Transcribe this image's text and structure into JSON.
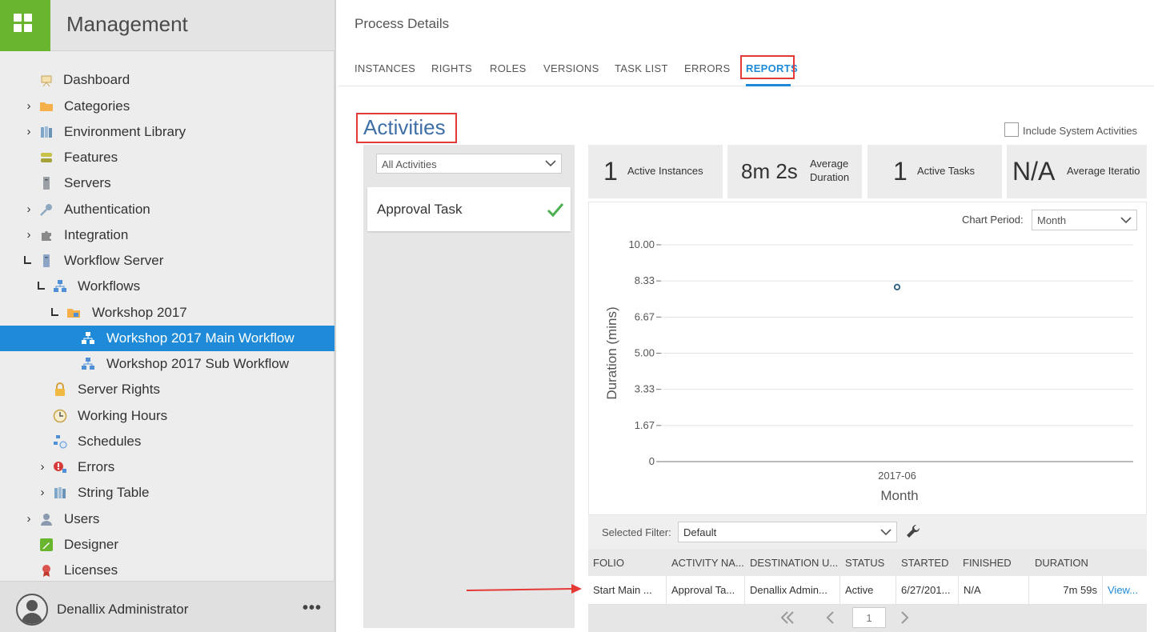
{
  "app": {
    "title": "Management"
  },
  "sidebar": {
    "items": [
      {
        "label": "Dashboard",
        "icon": "dashboard-icon"
      },
      {
        "label": "Categories",
        "icon": "folder-icon"
      },
      {
        "label": "Environment Library",
        "icon": "library-icon"
      },
      {
        "label": "Features",
        "icon": "features-icon"
      },
      {
        "label": "Servers",
        "icon": "server-icon"
      },
      {
        "label": "Authentication",
        "icon": "key-icon"
      },
      {
        "label": "Integration",
        "icon": "puzzle-icon"
      },
      {
        "label": "Workflow Server",
        "icon": "server-icon"
      },
      {
        "label": "Workflows",
        "icon": "workflow-icon"
      },
      {
        "label": "Workshop 2017",
        "icon": "workflow-folder-icon"
      },
      {
        "label": "Workshop 2017 Main Workflow",
        "icon": "workflow-icon"
      },
      {
        "label": "Workshop 2017 Sub Workflow",
        "icon": "workflow-icon"
      },
      {
        "label": "Server Rights",
        "icon": "lock-icon"
      },
      {
        "label": "Working Hours",
        "icon": "clock-icon"
      },
      {
        "label": "Schedules",
        "icon": "schedule-icon"
      },
      {
        "label": "Errors",
        "icon": "error-icon"
      },
      {
        "label": "String Table",
        "icon": "string-table-icon"
      },
      {
        "label": "Users",
        "icon": "user-icon"
      },
      {
        "label": "Designer",
        "icon": "pencil-icon"
      },
      {
        "label": "Licenses",
        "icon": "ribbon-icon"
      }
    ],
    "user": {
      "name": "Denallix Administrator",
      "more": "•••"
    }
  },
  "main": {
    "title": "Process Details",
    "tabs": [
      "INSTANCES",
      "RIGHTS",
      "ROLES",
      "VERSIONS",
      "TASK LIST",
      "ERRORS",
      "REPORTS"
    ],
    "active_tab": "REPORTS",
    "section_title": "Activities",
    "include_system_label": "Include System Activities",
    "activity_filter": "All Activities",
    "activities": [
      {
        "name": "Approval Task",
        "checked": true
      }
    ],
    "stats": [
      {
        "value": "1",
        "label": "Active Instances"
      },
      {
        "value": "8m 2s",
        "label_line1": "Average",
        "label_line2": "Duration"
      },
      {
        "value": "1",
        "label": "Active Tasks"
      },
      {
        "value": "N/A",
        "label": "Average Iteratio"
      }
    ],
    "chart_period_label": "Chart Period:",
    "chart_period": "Month",
    "selected_filter_label": "Selected Filter:",
    "selected_filter": "Default",
    "table": {
      "columns": [
        "FOLIO",
        "ACTIVITY NA...",
        "DESTINATION U...",
        "STATUS",
        "STARTED",
        "FINISHED",
        "DURATION"
      ],
      "rows": [
        [
          "Start Main ...",
          "Approval Ta...",
          "Denallix Admin...",
          "Active",
          "6/27/201...",
          "N/A",
          "7m 59s",
          "View..."
        ]
      ]
    },
    "pager": {
      "page": "1"
    }
  },
  "colors": {
    "accent": "#1f8bd8",
    "brand": "#6ab52f",
    "highlight": "#e53935",
    "title_blue": "#3f6fa8"
  },
  "chart_data": {
    "type": "scatter",
    "x": [
      "2017-06"
    ],
    "y": [
      8.05
    ],
    "ylim": [
      0,
      10
    ],
    "yticks": [
      "10.00",
      "8.33",
      "6.67",
      "5.00",
      "3.33",
      "1.67",
      "0"
    ],
    "xlabel": "Month",
    "ylabel": "Duration (mins)",
    "grid": true
  }
}
